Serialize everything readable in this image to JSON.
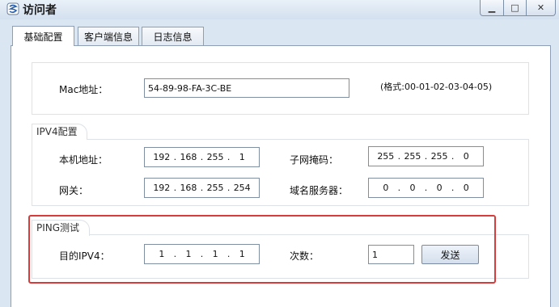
{
  "window": {
    "title": "访问者",
    "minimize_glyph": "▁",
    "maximize_glyph": "□",
    "close_glyph": "✕"
  },
  "tabs": [
    {
      "label": "基础配置",
      "active": true
    },
    {
      "label": "客户端信息",
      "active": false
    },
    {
      "label": "日志信息",
      "active": false
    }
  ],
  "mac_section": {
    "label": "Mac地址：",
    "value": "54-89-98-FA-3C-BE",
    "format_hint": "(格式:00-01-02-03-04-05)"
  },
  "ipv4_section": {
    "title": "IPV4配置",
    "local_ip_label": "本机地址：",
    "local_ip": [
      "192",
      "168",
      "255",
      "1"
    ],
    "subnet_label": "子网掩码：",
    "subnet": [
      "255",
      "255",
      "255",
      "0"
    ],
    "gateway_label": "网关：",
    "gateway": [
      "192",
      "168",
      "255",
      "254"
    ],
    "dns_label": "域名服务器：",
    "dns": [
      "0",
      "0",
      "0",
      "0"
    ]
  },
  "ping_section": {
    "title": "PING测试",
    "target_label": "目的IPV4：",
    "target": [
      "1",
      "1",
      "1",
      "1"
    ],
    "count_label": "次数：",
    "count": "1",
    "send_label": "发送"
  },
  "colors": {
    "highlight": "#d93a3a",
    "window_bg": "#dbe6f3"
  },
  "icons": {
    "app": "app-logo-icon"
  }
}
